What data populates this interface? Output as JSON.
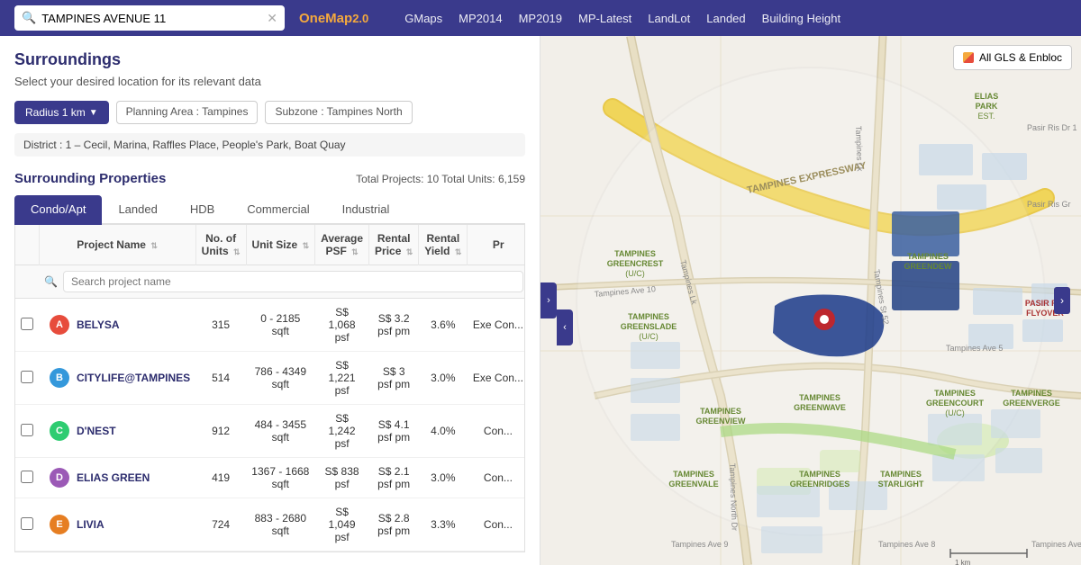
{
  "nav": {
    "search_placeholder": "TAMPINES AVENUE 11",
    "logo_text": "OneMap",
    "logo_version": "2.0",
    "links": [
      "GMaps",
      "MP2014",
      "MP2019",
      "MP-Latest",
      "LandLot",
      "Landed",
      "Building Height"
    ]
  },
  "left_panel": {
    "section_title": "Surroundings",
    "section_subtitle": "Select your desired location for its relevant data",
    "filters": {
      "radius": "Radius 1 km",
      "planning_area": "Planning Area : Tampines",
      "subzone": "Subzone : Tampines North"
    },
    "district": "District : 1 – Cecil, Marina, Raffles Place, People's Park, Boat Quay",
    "surrounding_title": "Surrounding Properties",
    "total_info": "Total Projects: 10  Total Units: 6,159",
    "tabs": [
      "Condo/Apt",
      "Landed",
      "HDB",
      "Commercial",
      "Industrial"
    ],
    "active_tab": "Condo/Apt",
    "table": {
      "columns": [
        "",
        "Project Name",
        "No. of Units",
        "Unit Size",
        "Average PSF",
        "Rental Price",
        "Rental Yield",
        "Pr"
      ],
      "search_placeholder": "Search project name",
      "rows": [
        {
          "badge": "A",
          "badge_class": "badge-a",
          "name": "BELYSA",
          "units": "315",
          "unit_size": "0 - 2185 sqft",
          "avg_psf": "S$ 1,068 psf",
          "rental_price": "S$ 3.2 psf pm",
          "rental_yield": "3.6%",
          "tenure": "Exe Con..."
        },
        {
          "badge": "B",
          "badge_class": "badge-b",
          "name": "CITYLIFE@TAMPINES",
          "units": "514",
          "unit_size": "786 - 4349 sqft",
          "avg_psf": "S$ 1,221 psf",
          "rental_price": "S$ 3 psf pm",
          "rental_yield": "3.0%",
          "tenure": "Exe Con..."
        },
        {
          "badge": "C",
          "badge_class": "badge-c",
          "name": "D'NEST",
          "units": "912",
          "unit_size": "484 - 3455 sqft",
          "avg_psf": "S$ 1,242 psf",
          "rental_price": "S$ 4.1 psf pm",
          "rental_yield": "4.0%",
          "tenure": "Con..."
        },
        {
          "badge": "D",
          "badge_class": "badge-d",
          "name": "ELIAS GREEN",
          "units": "419",
          "unit_size": "1367 - 1668 sqft",
          "avg_psf": "S$ 838 psf",
          "rental_price": "S$ 2.1 psf pm",
          "rental_yield": "3.0%",
          "tenure": "Con..."
        },
        {
          "badge": "E",
          "badge_class": "badge-e",
          "name": "LIVIA",
          "units": "724",
          "unit_size": "883 - 2680 sqft",
          "avg_psf": "S$ 1,049 psf",
          "rental_price": "S$ 2.8 psf pm",
          "rental_yield": "3.3%",
          "tenure": "Con..."
        }
      ]
    }
  },
  "map": {
    "overlay_label": "All GLS & Enbloc"
  }
}
